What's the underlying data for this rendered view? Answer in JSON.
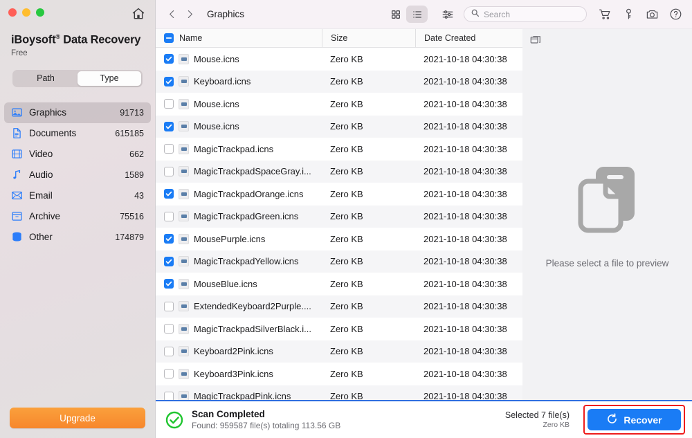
{
  "window": {
    "traffic_lights": [
      "close",
      "minimize",
      "maximize"
    ],
    "home_icon": "home-icon"
  },
  "sidebar": {
    "brand_name": "iBoysoft",
    "brand_registered": "®",
    "brand_product": " Data Recovery",
    "license": "Free",
    "segmented": {
      "options": [
        "Path",
        "Type"
      ],
      "selected": "Type"
    },
    "items": [
      {
        "label": "Graphics",
        "count": "91713",
        "icon": "image-icon",
        "active": true
      },
      {
        "label": "Documents",
        "count": "615185",
        "icon": "document-icon",
        "active": false
      },
      {
        "label": "Video",
        "count": "662",
        "icon": "film-icon",
        "active": false
      },
      {
        "label": "Audio",
        "count": "1589",
        "icon": "music-note-icon",
        "active": false
      },
      {
        "label": "Email",
        "count": "43",
        "icon": "envelope-icon",
        "active": false
      },
      {
        "label": "Archive",
        "count": "75516",
        "icon": "archive-box-icon",
        "active": false
      },
      {
        "label": "Other",
        "count": "174879",
        "icon": "database-icon",
        "active": false
      }
    ],
    "upgrade_label": "Upgrade"
  },
  "toolbar": {
    "back_icon": "chevron-left-icon",
    "forward_icon": "chevron-right-icon",
    "breadcrumb": "Graphics",
    "view_grid_icon": "grid-view-icon",
    "view_list_icon": "list-view-icon",
    "view_selected": "list",
    "filter_icon": "sliders-icon",
    "search": {
      "value": "",
      "placeholder": "Search",
      "icon": "search-icon"
    },
    "icons": [
      {
        "name": "cart-icon"
      },
      {
        "name": "key-icon"
      },
      {
        "name": "camera-icon"
      },
      {
        "name": "help-circle-icon"
      }
    ]
  },
  "table": {
    "select_all_state": "indeterminate",
    "columns": [
      "Name",
      "Size",
      "Date Created"
    ],
    "panes_icon": "panes-toggle-icon",
    "rows": [
      {
        "checked": true,
        "name": "Mouse.icns",
        "size": "Zero KB",
        "date": "2021-10-18 04:30:38"
      },
      {
        "checked": true,
        "name": "Keyboard.icns",
        "size": "Zero KB",
        "date": "2021-10-18 04:30:38"
      },
      {
        "checked": false,
        "name": "Mouse.icns",
        "size": "Zero KB",
        "date": "2021-10-18 04:30:38"
      },
      {
        "checked": true,
        "name": "Mouse.icns",
        "size": "Zero KB",
        "date": "2021-10-18 04:30:38"
      },
      {
        "checked": false,
        "name": "MagicTrackpad.icns",
        "size": "Zero KB",
        "date": "2021-10-18 04:30:38"
      },
      {
        "checked": false,
        "name": "MagicTrackpadSpaceGray.i...",
        "size": "Zero KB",
        "date": "2021-10-18 04:30:38"
      },
      {
        "checked": true,
        "name": "MagicTrackpadOrange.icns",
        "size": "Zero KB",
        "date": "2021-10-18 04:30:38"
      },
      {
        "checked": false,
        "name": "MagicTrackpadGreen.icns",
        "size": "Zero KB",
        "date": "2021-10-18 04:30:38"
      },
      {
        "checked": true,
        "name": "MousePurple.icns",
        "size": "Zero KB",
        "date": "2021-10-18 04:30:38"
      },
      {
        "checked": true,
        "name": "MagicTrackpadYellow.icns",
        "size": "Zero KB",
        "date": "2021-10-18 04:30:38"
      },
      {
        "checked": true,
        "name": "MouseBlue.icns",
        "size": "Zero KB",
        "date": "2021-10-18 04:30:38"
      },
      {
        "checked": false,
        "name": "ExtendedKeyboard2Purple....",
        "size": "Zero KB",
        "date": "2021-10-18 04:30:38"
      },
      {
        "checked": false,
        "name": "MagicTrackpadSilverBlack.i...",
        "size": "Zero KB",
        "date": "2021-10-18 04:30:38"
      },
      {
        "checked": false,
        "name": "Keyboard2Pink.icns",
        "size": "Zero KB",
        "date": "2021-10-18 04:30:38"
      },
      {
        "checked": false,
        "name": "Keyboard3Pink.icns",
        "size": "Zero KB",
        "date": "2021-10-18 04:30:38"
      },
      {
        "checked": false,
        "name": "MagicTrackpadPink.icns",
        "size": "Zero KB",
        "date": "2021-10-18 04:30:38"
      }
    ]
  },
  "preview": {
    "icon": "file-preview-placeholder-icon",
    "message": "Please select a file to preview"
  },
  "status": {
    "icon": "check-circle-icon",
    "title": "Scan Completed",
    "subtitle": "Found: 959587 file(s) totaling 113.56 GB",
    "selected_files": "Selected 7 file(s)",
    "selected_size": "Zero KB",
    "recover_label": "Recover",
    "recover_icon": "refresh-icon",
    "highlight_color": "#ee1c1c"
  },
  "colors": {
    "accent_blue": "#1a7cf5",
    "upgrade_orange": "#f7872c",
    "success_green": "#1fc52f",
    "icon_blue": "#2b7dfa"
  }
}
